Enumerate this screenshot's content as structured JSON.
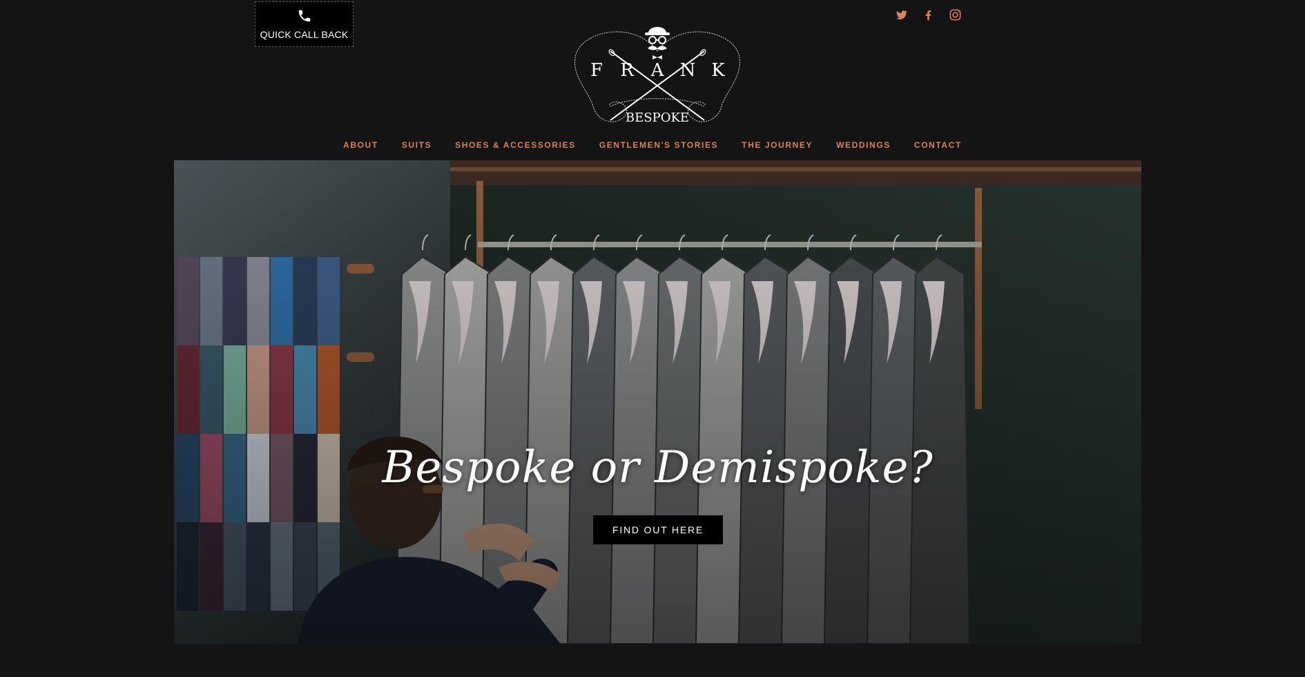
{
  "header": {
    "callback": {
      "label": "QUICK CALL BACK",
      "icon": "phone-icon"
    },
    "social": [
      {
        "name": "twitter",
        "icon": "twitter-icon"
      },
      {
        "name": "facebook",
        "icon": "facebook-icon"
      },
      {
        "name": "instagram",
        "icon": "instagram-icon"
      }
    ],
    "logo": {
      "brand": "FRANK",
      "letters": [
        "F",
        "R",
        "A",
        "N",
        "K"
      ],
      "sub": "BESPOKE"
    }
  },
  "nav": {
    "items": [
      {
        "label": "ABOUT"
      },
      {
        "label": "SUITS"
      },
      {
        "label": "SHOES & ACCESSORIES"
      },
      {
        "label": "GENTLEMEN'S STORIES"
      },
      {
        "label": "THE JOURNEY"
      },
      {
        "label": "WEDDINGS"
      },
      {
        "label": "CONTACT"
      }
    ]
  },
  "hero": {
    "title": "Bespoke or Demispoke?",
    "button_label": "FIND OUT HERE"
  },
  "colors": {
    "background": "#141414",
    "accent": "#d9845a",
    "button": "#000000"
  }
}
